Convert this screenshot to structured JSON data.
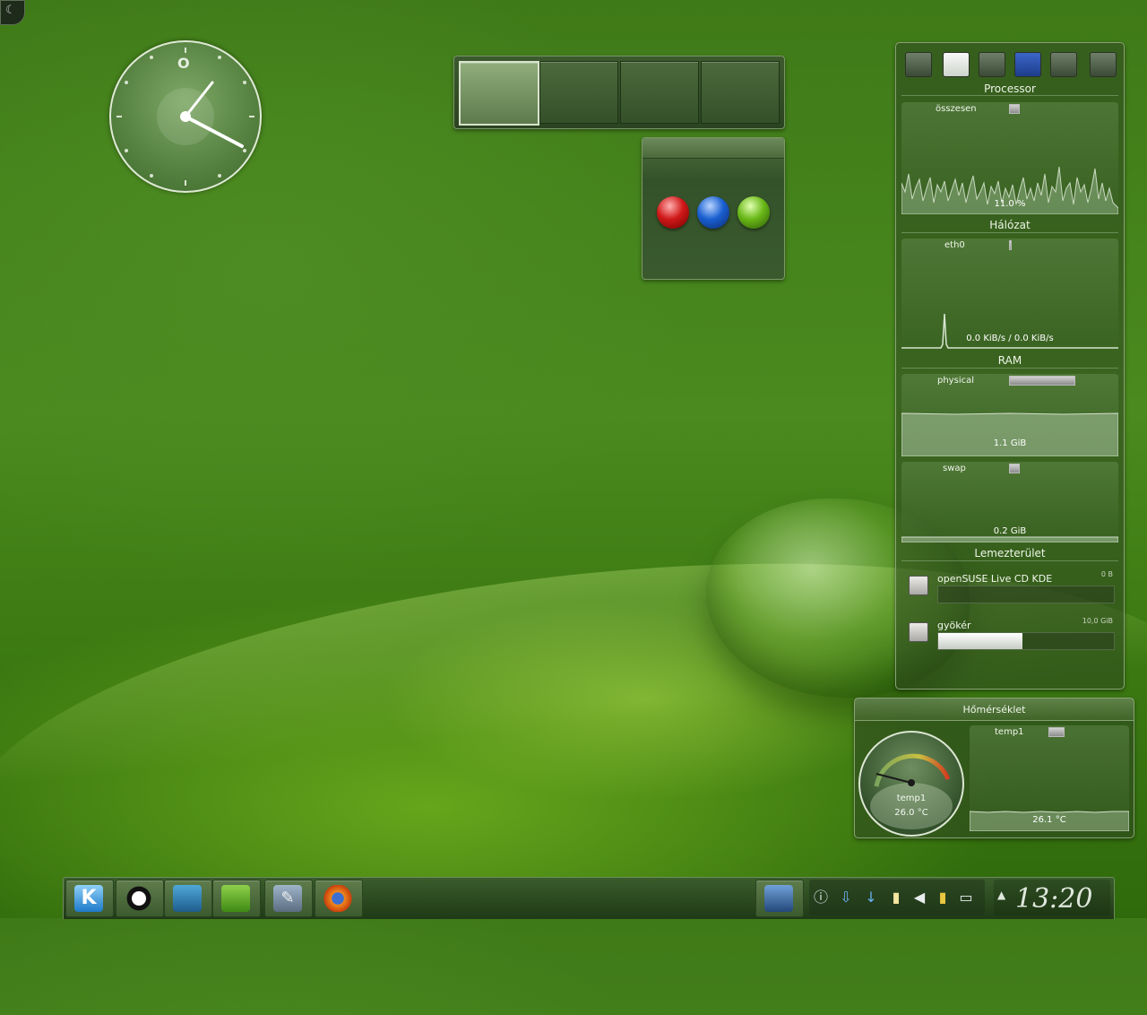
{
  "processor": {
    "title": "Processor",
    "label": "összesen",
    "value": "11.0 %"
  },
  "network": {
    "title": "Hálózat",
    "label": "eth0",
    "value": "0.0 KiB/s / 0.0 KiB/s"
  },
  "ram": {
    "title": "RAM",
    "physical_label": "physical",
    "physical_value": "1.1 GiB",
    "swap_label": "swap",
    "swap_value": "0.2 GiB"
  },
  "disk": {
    "title": "Lemezterület",
    "items": [
      {
        "name": "openSUSE Live CD KDE",
        "size": "0 B",
        "usage": 0
      },
      {
        "name": "gyökér",
        "size": "10,0 GiB",
        "usage": 0.48
      }
    ]
  },
  "temperature": {
    "title": "Hőmérséklet",
    "sensor": "temp1",
    "gauge_value": "26.0 °C",
    "graph_label": "temp1",
    "graph_value": "26.1 °C"
  },
  "clock": {
    "time": "13:20"
  },
  "pager": {
    "desktops": 4,
    "active": 1
  },
  "taskbar": {
    "launchers": [
      "kde-menu-icon",
      "amarok-icon",
      "system-monitor-icon",
      "notes-icon",
      "settings-icon",
      "firefox-icon"
    ],
    "tray": [
      "info-icon",
      "download-icon",
      "update-icon",
      "clipboard-icon",
      "volume-icon",
      "battery-icon",
      "display-icon"
    ]
  },
  "colors": {
    "accent": "#4a8a1e",
    "ball_red": "#d01818",
    "ball_blue": "#1a5fd0",
    "ball_green": "#6ab818"
  }
}
